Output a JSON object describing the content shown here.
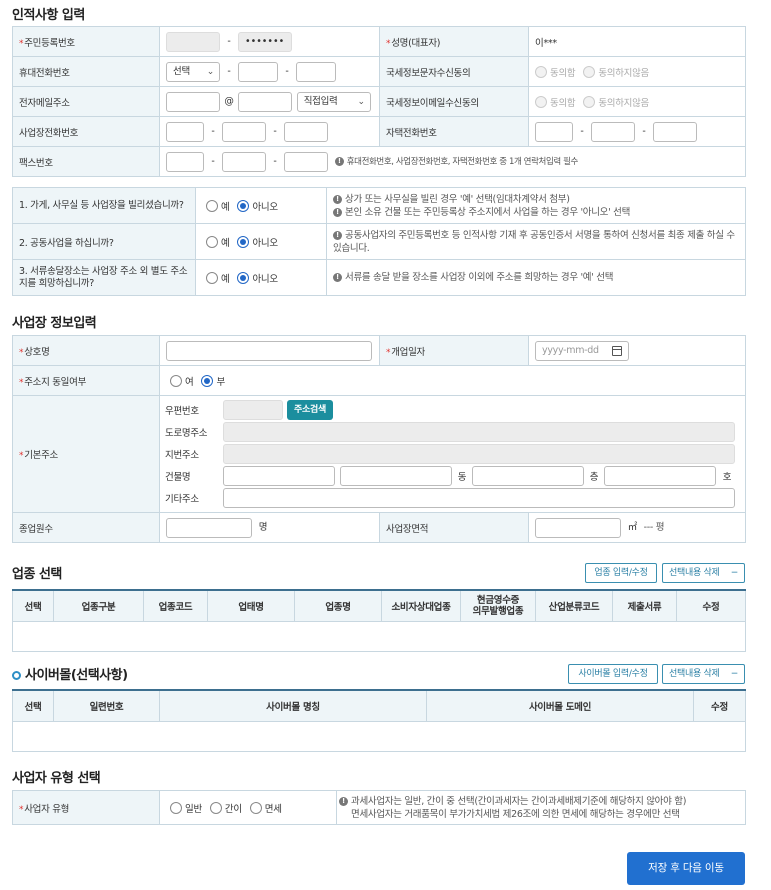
{
  "sections": {
    "personal": "인적사항 입력",
    "business": "사업장 정보입력",
    "industry": "업종 선택",
    "cybermall": "사이버몰(선택사항)",
    "biztype": "사업자 유형 선택"
  },
  "personal": {
    "rrn_label": "주민등록번호",
    "rrn_back": "•••••••",
    "name_label": "성명(대표자)",
    "name_value": "이***",
    "mobile_label": "휴대전화번호",
    "mobile_select": "선택",
    "sms_consent_label": "국세정보문자수신동의",
    "email_label": "전자메일주소",
    "email_at": "@",
    "email_select": "직접입력",
    "email_consent_label": "국세정보이메일수신동의",
    "consent_yes": "동의함",
    "consent_no": "동의하지않음",
    "biz_phone_label": "사업장전화번호",
    "home_phone_label": "자택전화번호",
    "fax_label": "팩스번호",
    "fax_note": "휴대전화번호, 사업장전화번호, 자택전화번호 중 1개 연락처입력 필수"
  },
  "questions": [
    {
      "q": "1. 가게, 사무실 등 사업장을 빌리셨습니까?",
      "yes": "예",
      "no": "아니오",
      "notes": [
        "상가 또는 사무실을 빌린 경우 '예' 선택(임대차계약서 첨부)",
        "본인 소유 건물 또는 주민등록상 주소지에서 사업을 하는 경우 '아니오' 선택"
      ]
    },
    {
      "q": "2. 공동사업을 하십니까?",
      "yes": "예",
      "no": "아니오",
      "notes": [
        "공동사업자의 주민등록번호 등 인적사항 기재 후 공동인증서 서명을 통하여 신청서를 최종 제출 하실 수 있습니다."
      ]
    },
    {
      "q": "3. 서류송달장소는 사업장 주소 외 별도 주소지를 희망하십니까?",
      "yes": "예",
      "no": "아니오",
      "notes": [
        "서류를 송달 받을 장소를 사업장 이외에 주소를 희망하는 경우 '예' 선택"
      ]
    }
  ],
  "business": {
    "trade_name_label": "상호명",
    "open_date_label": "개업일자",
    "open_date_placeholder": "yyyy-mm-dd",
    "same_address_label": "주소지 동일여부",
    "same_yes": "여",
    "same_no": "부",
    "address_label": "기본주소",
    "postcode_label": "우편번호",
    "address_search": "주소검색",
    "road_label": "도로명주소",
    "lot_label": "지번주소",
    "building_label": "건물명",
    "dong": "동",
    "floor": "층",
    "ho": "호",
    "etc_label": "기타주소",
    "employees_label": "종업원수",
    "employees_unit": "명",
    "area_label": "사업장면적",
    "area_unit": "㎡",
    "area_pyeong": "--- 평"
  },
  "industry": {
    "edit_btn": "업종 입력/수정",
    "delete_btn": "선택내용 삭제",
    "columns": [
      "선택",
      "업종구분",
      "업종코드",
      "업태명",
      "업종명",
      "소비자상대업종",
      "현금영수증\n의무발행업종",
      "산업분류코드",
      "제출서류",
      "수정"
    ]
  },
  "cybermall": {
    "edit_btn": "사이버몰 입력/수정",
    "delete_btn": "선택내용 삭제",
    "columns": [
      "선택",
      "일련번호",
      "사이버몰 명칭",
      "사이버몰 도메인",
      "수정"
    ]
  },
  "biztype": {
    "label": "사업자 유형",
    "general": "일반",
    "simple": "간이",
    "exempt": "면세",
    "note1": "과세사업자는 일반, 간이 중 선택(간이과세자는 간이과세배제기준에 해당하지 않아야 함)",
    "note2": "면세사업자는 거래품목이 부가가치세법 제26조에 의한 면세에 해당하는 경우에만 선택"
  },
  "footer": {
    "save_next": "저장 후 다음 이동"
  },
  "colors": {
    "accent": "#2170d0",
    "teal": "#1b8e9e",
    "label_bg": "#eef5f8",
    "required": "#e0322f"
  }
}
